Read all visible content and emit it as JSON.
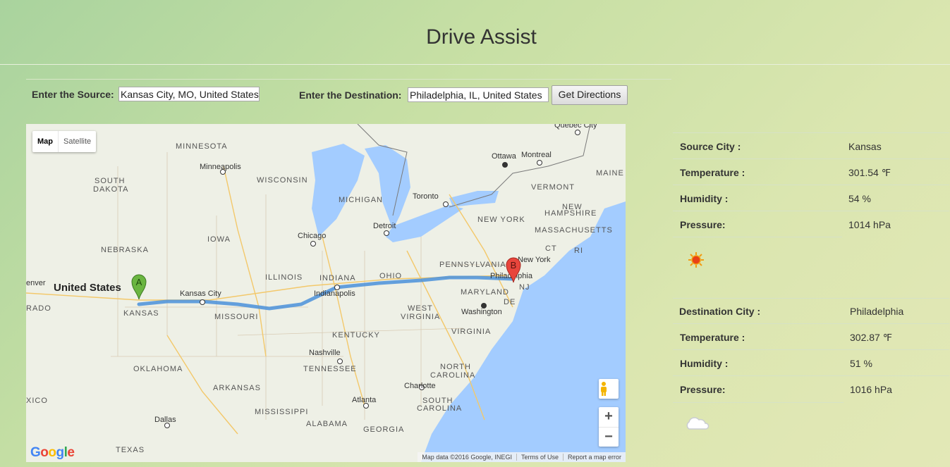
{
  "header": {
    "title": "Drive Assist"
  },
  "form": {
    "source_label": "Enter the Source:",
    "source_value": "Kansas City, MO, United States",
    "destination_label": "Enter the Destination:",
    "destination_value": "Philadelphia, IL, United States",
    "button_label": "Get Directions"
  },
  "map": {
    "type_map": "Map",
    "type_satellite": "Satellite",
    "marker_a": "A",
    "marker_b": "B",
    "logo": "Google",
    "zoom_in": "+",
    "zoom_out": "−",
    "attribution": {
      "data": "Map data ©2016 Google, INEGI",
      "terms": "Terms of Use",
      "report": "Report a map error"
    },
    "labels": {
      "quebec": "Quebec City",
      "ottawa": "Ottawa",
      "montreal": "Montreal",
      "minnesota": "MINNESOTA",
      "maine": "MAINE",
      "minneapolis": "Minneapolis",
      "south_dakota_1": "SOUTH",
      "south_dakota_2": "DAKOTA",
      "wisconsin": "WISCONSIN",
      "vermont": "VERMONT",
      "toronto": "Toronto",
      "michigan": "MICHIGAN",
      "nh_1": "NEW",
      "nh_2": "HAMPSHIRE",
      "iowa": "IOWA",
      "detroit": "Detroit",
      "new_york_state": "NEW YORK",
      "massachusetts": "MASSACHUSETTS",
      "chicago": "Chicago",
      "nebraska": "NEBRASKA",
      "ct": "CT",
      "ri": "RI",
      "pennsylvania": "PENNSYLVANIA",
      "new_york_city": "New York",
      "denver": "enver",
      "united_states": "United States",
      "illinois": "ILLINOIS",
      "indiana": "INDIANA",
      "ohio": "OHIO",
      "philadelphia": "Philadelphia",
      "kansas_city": "Kansas City",
      "indianapolis": "Indianapolis",
      "nj": "NJ",
      "maryland": "MARYLAND",
      "rado": "RADO",
      "kansas": "KANSAS",
      "de": "DE",
      "missouri": "MISSOURI",
      "wv_1": "WEST",
      "wv_2": "VIRGINIA",
      "washington": "Washington",
      "virginia": "VIRGINIA",
      "kentucky": "KENTUCKY",
      "nashville": "Nashville",
      "oklahoma": "OKLAHOMA",
      "tennessee": "TENNESSEE",
      "nc_1": "NORTH",
      "nc_2": "CAROLINA",
      "arkansas": "ARKANSAS",
      "charlotte": "Charlotte",
      "mexico": "XICO",
      "atlanta": "Atlanta",
      "sc_1": "SOUTH",
      "sc_2": "CAROLINA",
      "mississippi": "MISSISSIPPI",
      "dallas": "Dallas",
      "alabama": "ALABAMA",
      "georgia": "GEORGIA",
      "texas": "TEXAS"
    }
  },
  "source_weather": {
    "city_label": "Source City :",
    "city": "Kansas",
    "temp_label": "Temperature :",
    "temp": "301.54 ℉",
    "humidity_label": "Humidity :",
    "humidity": "54 %",
    "pressure_label": "Pressure:",
    "pressure": "1014 hPa",
    "icon": "sun-icon"
  },
  "destination_weather": {
    "city_label": "Destination City :",
    "city": "Philadelphia",
    "temp_label": "Temperature :",
    "temp": "302.87 ℉",
    "humidity_label": "Humidity :",
    "humidity": "51 %",
    "pressure_label": "Pressure:",
    "pressure": "1016 hPa",
    "icon": "cloud-icon"
  },
  "colors": {
    "route": "#4a90d9",
    "marker_a": "#6ab540",
    "marker_b": "#e8453c",
    "water": "#a3ccff"
  }
}
